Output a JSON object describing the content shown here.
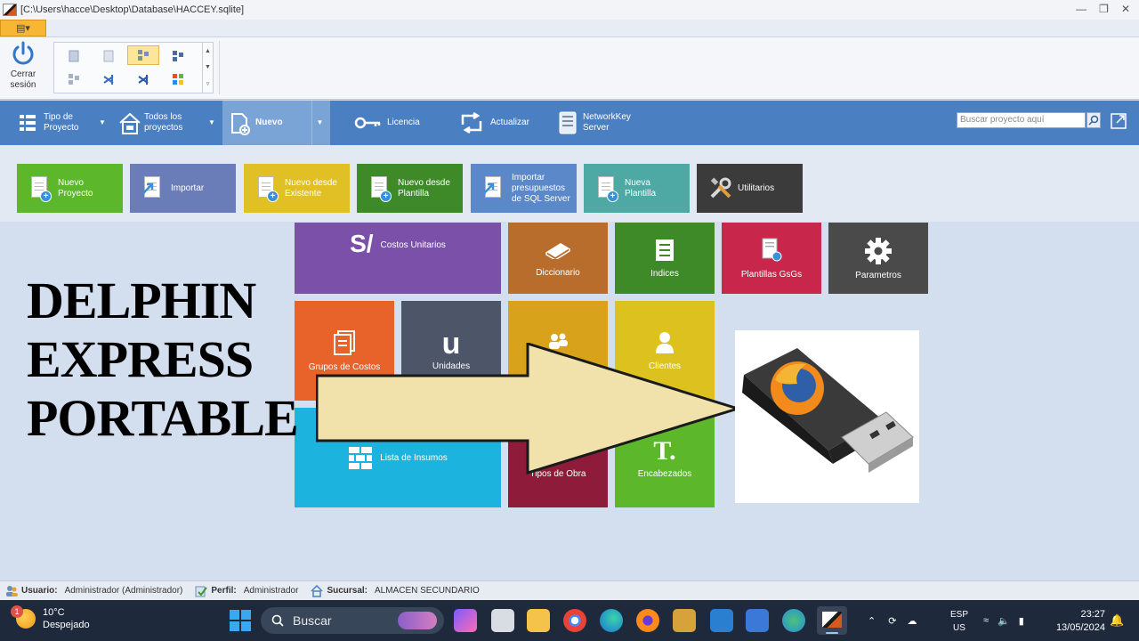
{
  "window": {
    "title": "[C:\\Users\\hacce\\Desktop\\Database\\HACCEY.sqlite]",
    "controls": [
      "minimize",
      "restore",
      "close"
    ]
  },
  "ribbon": {
    "logout_label": "Cerrar sesión"
  },
  "toolbar": {
    "items": [
      {
        "label": "Tipo de Proyecto",
        "icon": "list-icon"
      },
      {
        "label": "Todos los proyectos",
        "icon": "home-icon"
      },
      {
        "label": "Nuevo",
        "icon": "new-doc-icon",
        "selected": true
      },
      {
        "label": "Licencia",
        "icon": "key-icon"
      },
      {
        "label": "Actualizar",
        "icon": "refresh-icon"
      },
      {
        "label": "NetworkKey Server",
        "icon": "server-icon"
      }
    ],
    "search_placeholder": "Buscar proyecto aquí"
  },
  "actions": [
    {
      "label": "Nuevo Proyecto",
      "color": "#5cb82a"
    },
    {
      "label": "Importar",
      "color": "#6a7db9"
    },
    {
      "label": "Nuevo desde Existente",
      "color": "#e0c025"
    },
    {
      "label": "Nuevo desde Plantilla",
      "color": "#3e8a28"
    },
    {
      "label": "Importar presupuestos de SQL Server",
      "color": "#5b88c9"
    },
    {
      "label": "Nueva Plantilla",
      "color": "#4ea8a4"
    },
    {
      "label": "Utilitarios",
      "color": "#3b3b3b"
    }
  ],
  "tiles": {
    "costos_unitarios": {
      "label": "Costos Unitarios",
      "glyph": "S/",
      "color": "#7b50a8"
    },
    "diccionario": {
      "label": "Diccionario",
      "color": "#b86d2c"
    },
    "indices": {
      "label": "Indices",
      "color": "#3e8a28"
    },
    "plantillas": {
      "label": "Plantillas GsGs",
      "color": "#c8264a"
    },
    "parametros": {
      "label": "Parametros",
      "color": "#4a4a4a"
    },
    "grupos": {
      "label": "Grupos de Costos",
      "color": "#e8632a"
    },
    "unidades": {
      "label": "Unidades",
      "glyph": "u",
      "color": "#4d5568"
    },
    "personal": {
      "label": "",
      "color": "#d9a21b"
    },
    "clientes": {
      "label": "Clientes",
      "color": "#ddc21f"
    },
    "insumos": {
      "label": "Lista de Insumos",
      "color": "#1cb4de"
    },
    "tipos_obra": {
      "label": "Tipos de Obra",
      "color": "#8e1b3a"
    },
    "encabezados": {
      "label": "Encabezados",
      "glyph": "T.",
      "color": "#5cb82a"
    }
  },
  "overlay": {
    "title_lines": [
      "DELPHIN",
      "EXPRESS",
      "PORTABLE"
    ]
  },
  "status": {
    "usuario_key": "Usuario:",
    "usuario_val": "Administrador (Administrador)",
    "perfil_key": "Perfil:",
    "perfil_val": "Administrador",
    "sucursal_key": "Sucursal:",
    "sucursal_val": "ALMACEN SECUNDARIO"
  },
  "taskbar": {
    "weather_badge": "1",
    "temperature": "10°C",
    "condition": "Despejado",
    "search": "Buscar",
    "lang1": "ESP",
    "lang2": "US",
    "time": "23:27",
    "date": "13/05/2024"
  }
}
